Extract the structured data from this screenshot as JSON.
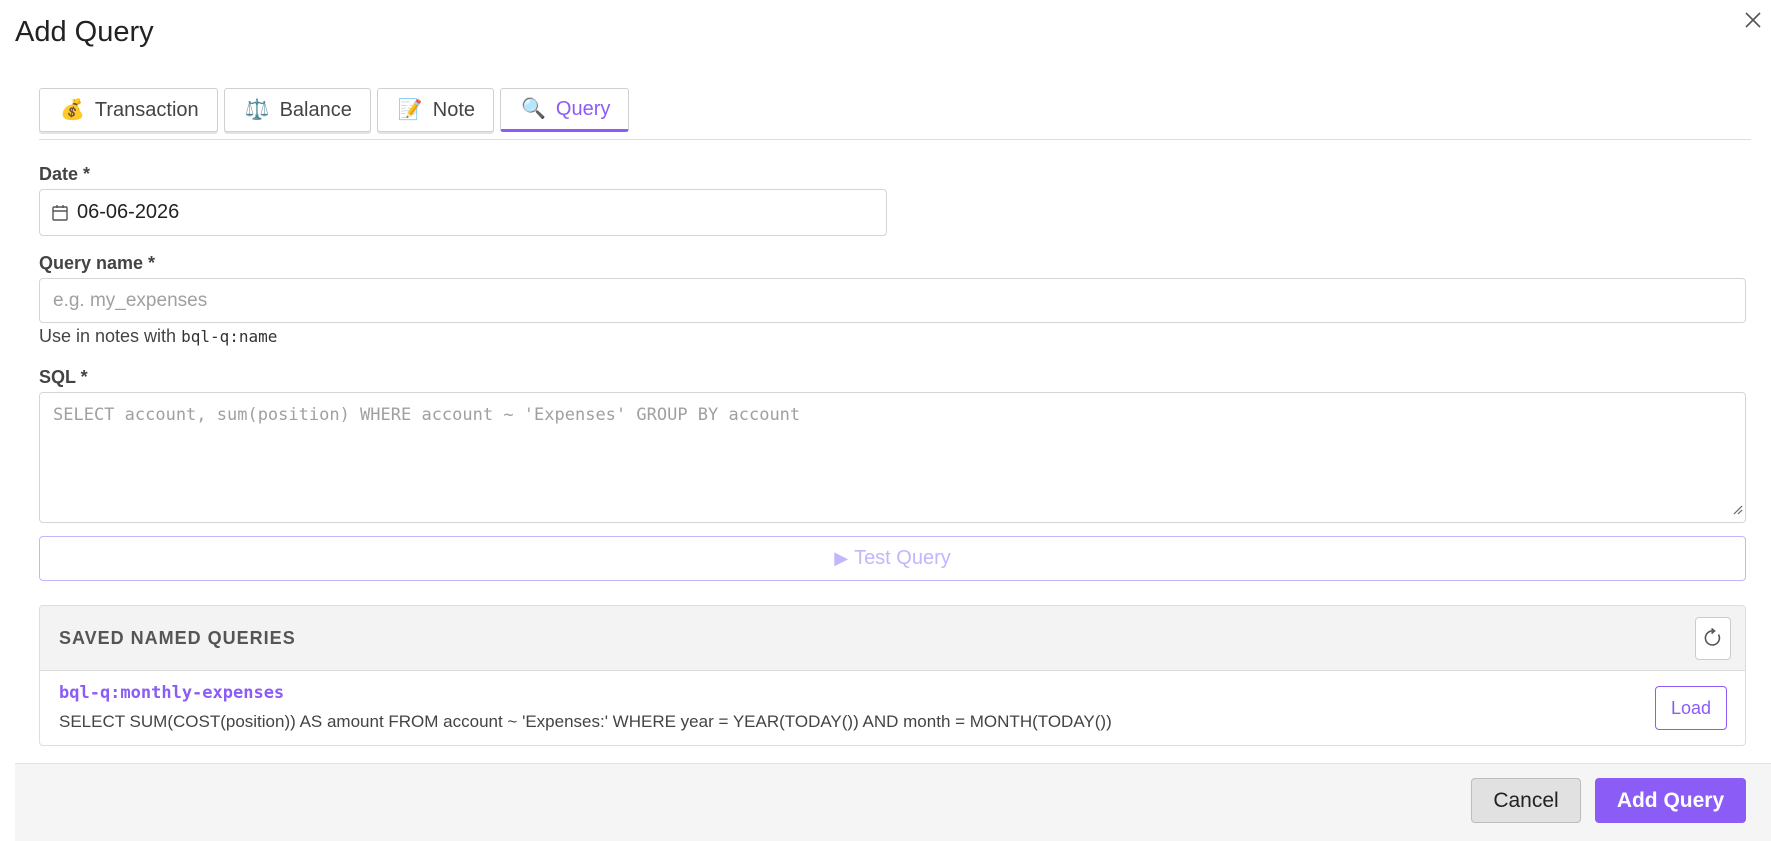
{
  "dialog": {
    "title": "Add Query",
    "close_glyph": "✕"
  },
  "tabs": [
    {
      "icon": "money-bag-icon",
      "glyph": "💰",
      "label": "Transaction",
      "active": false
    },
    {
      "icon": "scales-icon",
      "glyph": "⚖️",
      "label": "Balance",
      "active": false
    },
    {
      "icon": "memo-icon",
      "glyph": "📝",
      "label": "Note",
      "active": false
    },
    {
      "icon": "magnifier-icon",
      "glyph": "🔍",
      "label": "Query",
      "active": true
    }
  ],
  "form": {
    "date": {
      "label": "Date *",
      "value": "06-06-2026"
    },
    "query_name": {
      "label": "Query name *",
      "value": "",
      "placeholder": "e.g. my_expenses",
      "help_prefix": "Use in notes with ",
      "help_code": "bql-q:name"
    },
    "sql": {
      "label": "SQL *",
      "value": "",
      "placeholder": "SELECT account, sum(position) WHERE account ~ 'Expenses' GROUP BY account"
    },
    "test_button": {
      "icon": "play-icon",
      "glyph": "▶",
      "label": "Test Query"
    }
  },
  "saved_queries": {
    "title": "SAVED NAMED QUERIES",
    "refresh_icon": "refresh-icon",
    "items": [
      {
        "name": "bql-q:monthly-expenses",
        "sql": "SELECT SUM(COST(position)) AS amount FROM account ~ 'Expenses:' WHERE year = YEAR(TODAY()) AND month = MONTH(TODAY())",
        "action_label": "Load"
      }
    ]
  },
  "footer": {
    "cancel_label": "Cancel",
    "submit_label": "Add Query"
  },
  "colors": {
    "accent": "#8b5cf6",
    "accent_light": "#c4b5fd",
    "border": "#d5d5d5",
    "footer_bg": "#f5f5f5"
  }
}
